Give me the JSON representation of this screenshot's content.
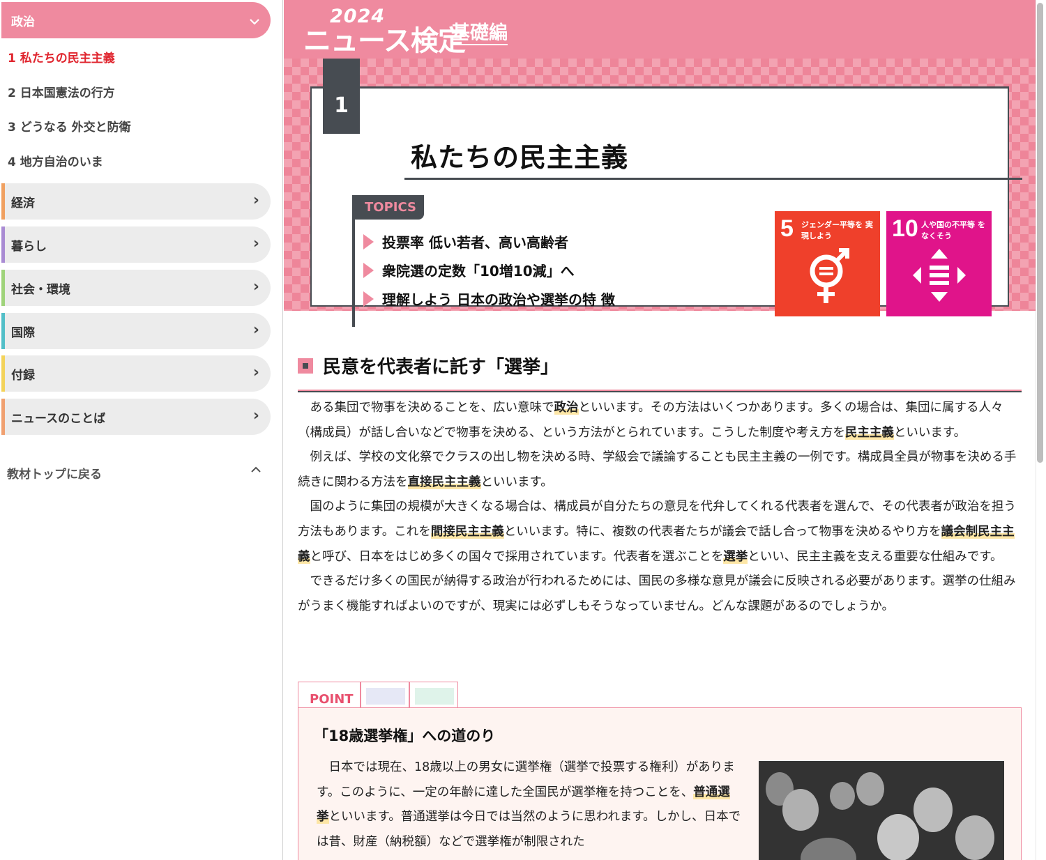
{
  "sidebar": {
    "active_category": "政治",
    "subitems": [
      "1 私たちの民主主義",
      "2 日本国憲法の行方",
      "3 どうなる 外交と防衛",
      "4 地方自治のいま"
    ],
    "categories": [
      {
        "label": "経済",
        "color": "#f0a060"
      },
      {
        "label": "暮らし",
        "color": "#a98bd3"
      },
      {
        "label": "社会・環境",
        "color": "#9fd37a"
      },
      {
        "label": "国際",
        "color": "#52bfc8"
      },
      {
        "label": "付録",
        "color": "#f3d35a"
      },
      {
        "label": "ニュースのことば",
        "color": "#f0a070"
      }
    ],
    "back_label": "教材トップに戻る"
  },
  "header": {
    "year": "2024",
    "title": "ニュース検定",
    "subtitle": "基礎編",
    "bg_color": "#ef8a9f"
  },
  "chapter": {
    "number": "1",
    "title": "私たちの民主主義",
    "topics_label": "TOPICS",
    "topics": [
      "投票率 低い若者、高い高齢者",
      "衆院選の定数「10増10減」へ",
      "理解しよう 日本の政治や選挙の特 徴"
    ],
    "sdgs": [
      {
        "number": "5",
        "text": "ジェンダー平等を 実現しよう",
        "color": "#ef402b",
        "icon": "gender-equality-icon"
      },
      {
        "number": "10",
        "text": "人や国の不平等 をなくそう",
        "color": "#e0148a",
        "icon": "reduced-inequality-icon"
      }
    ]
  },
  "section": {
    "heading": "民意を代表者に託す「選挙」",
    "paragraphs": [
      [
        "ある集団で物事を決めることを、広い意味で",
        "政治",
        "といいます。その方法はいくつかあります。多くの場合は、集団に属する人々（構成員）が話し合いなどで物事を決める、という方法がとられています。こうした制度や考え方を",
        "民主主義",
        "といいます。"
      ],
      [
        "例えば、学校の文化祭でクラスの出し物を決める時、学級会で議論することも民主主義の一例です。構成員全員が物事を決める手続きに関わる方法を",
        "直接民主主義",
        "といいます。"
      ],
      [
        "国のように集団の規模が大きくなる場合は、構成員が自分たちの意見を代弁してくれる代表者を選んで、その代表者が政治を担う方法もあります。これを",
        "間接民主主義",
        "といいます。特に、複数の代表者たちが議会で話し合って物事を決めるやり方を",
        "議会制民主主義",
        "と呼び、日本をはじめ多くの国々で採用されています。代表者を選ぶことを",
        "選挙",
        "といい、民主主義を支える重要な仕組みです。"
      ],
      [
        "できるだけ多くの国民が納得する政治が行われるためには、国民の多様な意見が議会に反映される必要があります。選挙の仕組みがうまく機能すればよいのですが、現実には必ずしもそうなっていません。どんな課題があるのでしょうか。"
      ]
    ]
  },
  "point": {
    "tab_label": "POINT",
    "title": "「18歳選挙権」への道のり",
    "paragraph": [
      "日本では現在、18歳以上の男女に選挙権（選挙で投票する権利）があります。このように、一定の年齢に達した全国民が選挙権を持つことを、",
      "普通選挙",
      "といいます。普通選挙は今日では当然のように思われます。しかし、日本では昔、財産（納税額）などで選挙権が制限された"
    ]
  }
}
